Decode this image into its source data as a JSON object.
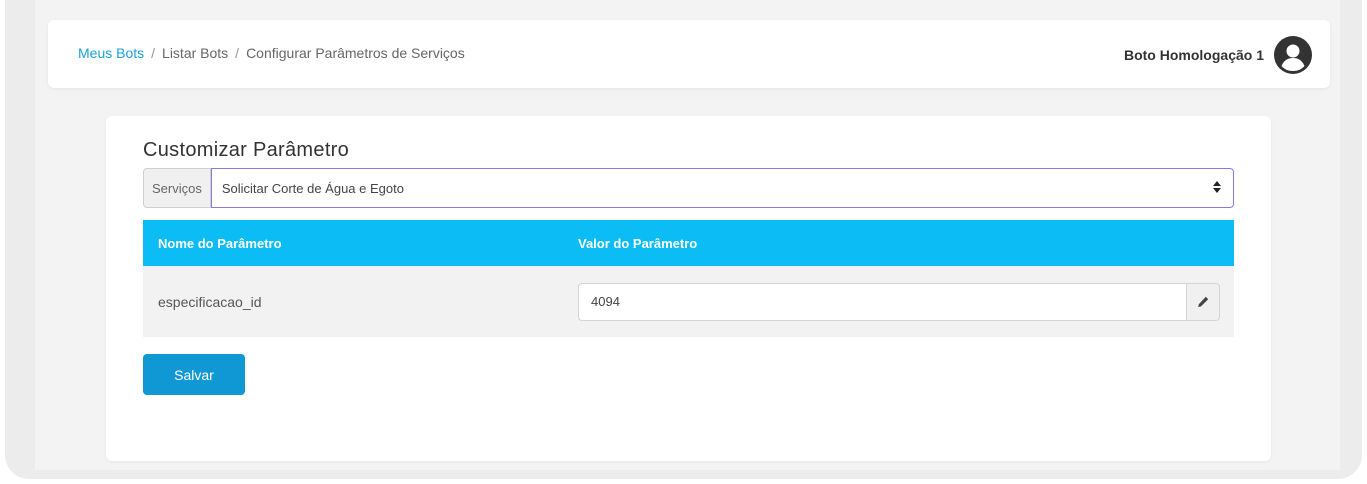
{
  "breadcrumb": {
    "items": [
      "Meus Bots",
      "Listar Bots",
      "Configurar Parâmetros de Serviços"
    ],
    "separator": "/"
  },
  "user": {
    "name": "Boto Homologação 1",
    "avatar_icon": "user-circle-icon"
  },
  "card": {
    "title": "Customizar Parâmetro",
    "service_label": "Serviços",
    "service_selected": "Solicitar Corte de Água e Egoto"
  },
  "table": {
    "headers": [
      "Nome do Parâmetro",
      "Valor do Parâmetro"
    ],
    "rows": [
      {
        "name": "especificacao_id",
        "value": "4094"
      }
    ]
  },
  "actions": {
    "save_label": "Salvar"
  },
  "colors": {
    "link": "#1aa3d9",
    "table_header": "#0cbcf4",
    "primary_button": "#1098d4",
    "select_focus_border": "#8e7ad8"
  }
}
